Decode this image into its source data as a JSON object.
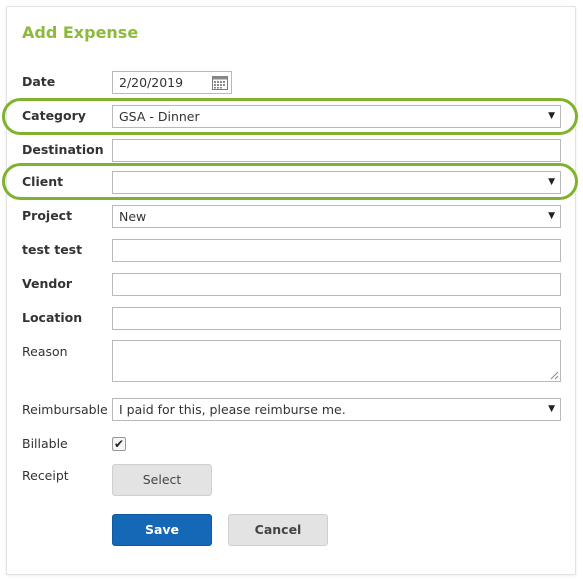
{
  "form": {
    "title": "Add Expense",
    "date": {
      "label": "Date",
      "value": "2/20/2019"
    },
    "category": {
      "label": "Category",
      "value": "GSA - Dinner"
    },
    "destination": {
      "label": "Destination",
      "value": ""
    },
    "client": {
      "label": "Client",
      "value": ""
    },
    "project": {
      "label": "Project",
      "value": "New"
    },
    "test_test": {
      "label": "test test",
      "value": ""
    },
    "vendor": {
      "label": "Vendor",
      "value": ""
    },
    "location": {
      "label": "Location",
      "value": ""
    },
    "reason": {
      "label": "Reason",
      "value": ""
    },
    "reimbursable": {
      "label": "Reimbursable",
      "value": "I paid for this, please reimburse me."
    },
    "billable": {
      "label": "Billable",
      "checked": true,
      "check_glyph": "✔"
    },
    "receipt": {
      "label": "Receipt",
      "button": "Select"
    },
    "dropdown_glyph": "▼"
  },
  "actions": {
    "save": "Save",
    "cancel": "Cancel"
  },
  "colors": {
    "accent": "#8dba3c",
    "highlight": "#7fb32d",
    "primary_button": "#1468b6"
  }
}
